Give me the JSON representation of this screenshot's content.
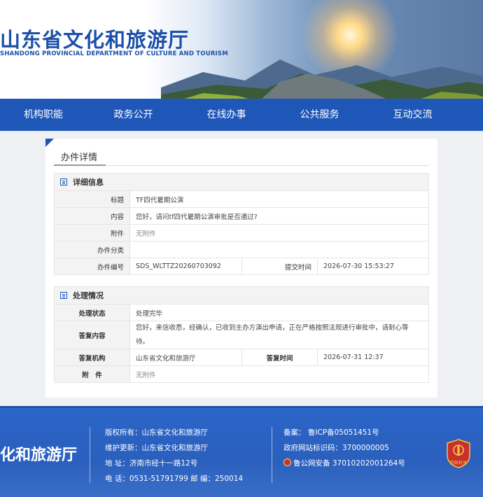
{
  "header": {
    "title": "山东省文化和旅游厅",
    "subtitle": "SHANDONG PROVINCIAL DEPARTMENT OF CULTURE AND TOURISM"
  },
  "nav": {
    "items": [
      "机构职能",
      "政务公开",
      "在线办事",
      "公共服务",
      "互动交流"
    ]
  },
  "card": {
    "title": "办件详情",
    "detail_section": {
      "label": "详细信息",
      "title_label": "标题",
      "title_value": "TF四代暑期公演",
      "content_label": "内容",
      "content_value": "您好，请问tf四代暑期公演审批是否通过?",
      "attachment_label": "附件",
      "attachment_value": "无附件",
      "category_label": "办件分类",
      "category_value": "",
      "number_label": "办件编号",
      "number_value": "SDS_WLTTZ20260703092",
      "submit_time_label": "提交时间",
      "submit_time_value": "2026-07-30 15:53:27"
    },
    "process_section": {
      "label": "处理情况",
      "status_label": "处理状态",
      "status_value": "处理完毕",
      "reply_label": "答复内容",
      "reply_value": "您好，来信收悉，经确认，已收到主办方演出申请，正在严格按照法规进行审批中，请耐心等待。",
      "org_label": "答复机构",
      "org_value": "山东省文化和旅游厅",
      "reply_time_label": "答复时间",
      "reply_time_value": "2026-07-31 12:37",
      "attachment_label": "附　件",
      "attachment_value": "无附件"
    }
  },
  "footer": {
    "logo": "化和旅游厅",
    "copyright": "版权所有：山东省文化和旅游厅",
    "maintainer": "维护更新：山东省文化和旅游厅",
    "address": "地  址：济南市经十一路12号",
    "contact": "电  话：0531-51791799 邮  编：250014",
    "icp": "备案：  鲁ICP备05051451号",
    "site_code": "政府网站标识码：3700000005",
    "police": "鲁公网安备 37010202001264号",
    "badge_text": "党政机关"
  },
  "colors": {
    "brand_blue": "#1f57b8",
    "footer_blue": "#2c66c8"
  }
}
